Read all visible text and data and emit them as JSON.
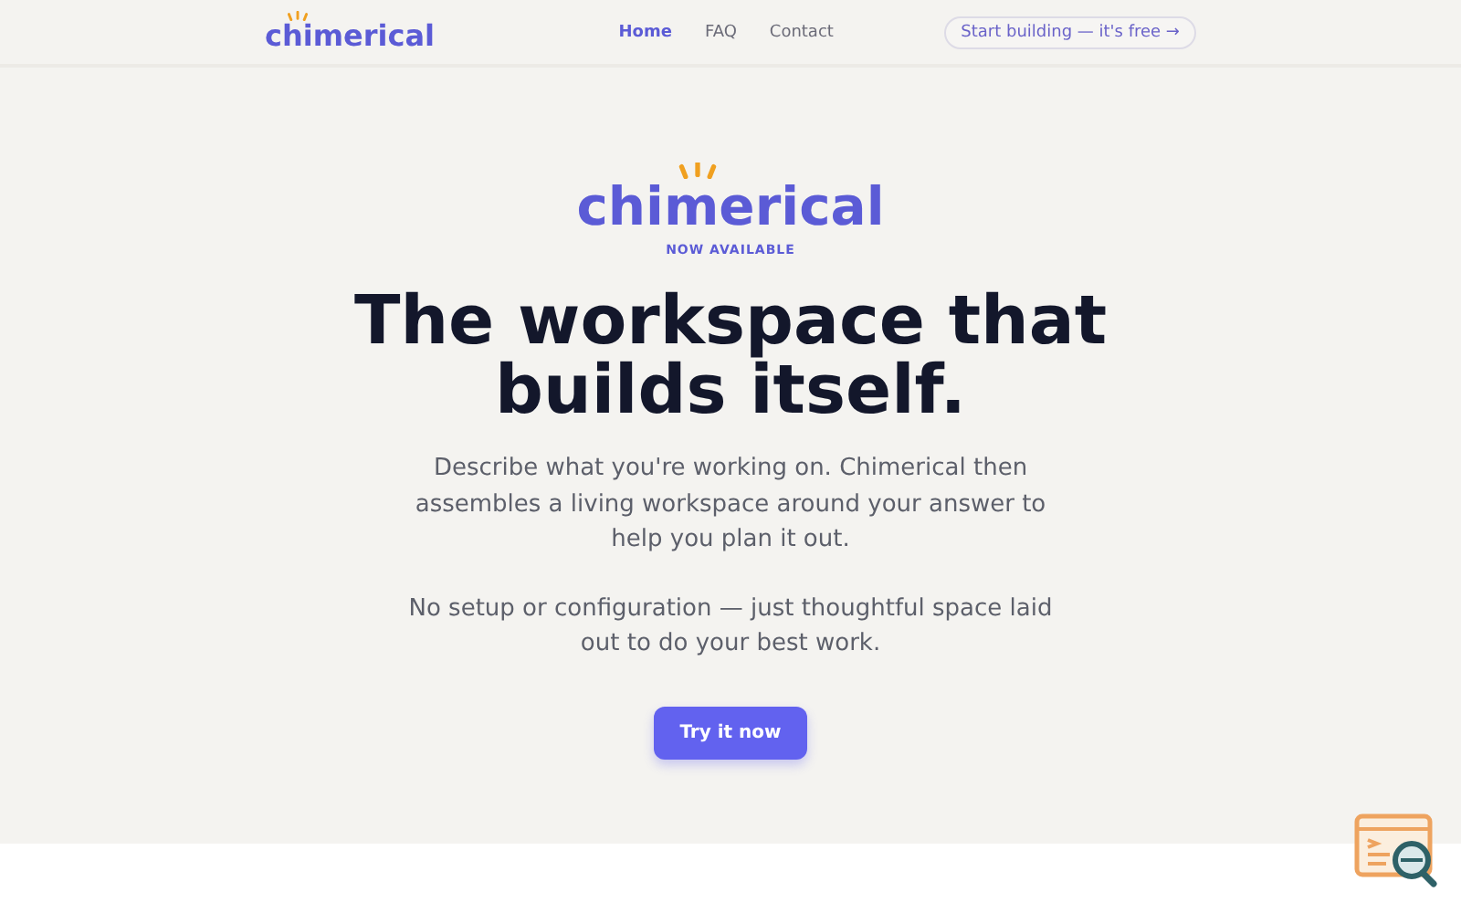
{
  "header": {
    "logo": "chimerical",
    "nav": [
      {
        "label": "Home",
        "selected": true
      },
      {
        "label": "FAQ",
        "selected": false
      },
      {
        "label": "Contact",
        "selected": false
      }
    ],
    "cta": "Start building — it's free →"
  },
  "hero": {
    "logo": "chimerical",
    "badge": "NOW AVAILABLE",
    "title": "The workspace that builds itself.",
    "paragraphs": [
      "Describe what you're working on. Chimerical then assembles a living workspace around your answer to help you plan it out.",
      "No setup or configuration — just thoughtful space laid out to do your best work."
    ],
    "button": "Try it now"
  }
}
